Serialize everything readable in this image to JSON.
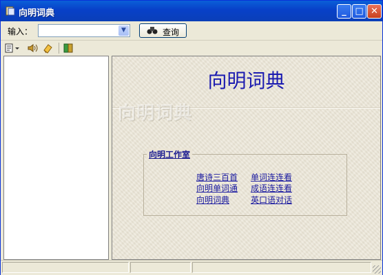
{
  "window": {
    "title": "向明词典"
  },
  "toolbar": {
    "input_label": "输入：",
    "input_value": "",
    "query_label": "查询",
    "query_icon": "binoculars-icon"
  },
  "icons": [
    "lookup-dropdown-icon",
    "speaker-icon",
    "eraser-icon",
    "book-icon"
  ],
  "content": {
    "title": "向明词典",
    "watermark": "向明词典",
    "group_title": "向明工作室",
    "links": [
      {
        "label": "唐诗三百首"
      },
      {
        "label": "单词连连看"
      },
      {
        "label": "向明单词通"
      },
      {
        "label": "成语连连看"
      },
      {
        "label": "向明词典"
      },
      {
        "label": "英口语对话"
      }
    ]
  },
  "colors": {
    "titlebar": "#0a3fb8",
    "link": "#1a1aa0",
    "heading": "#1a1ab0"
  }
}
